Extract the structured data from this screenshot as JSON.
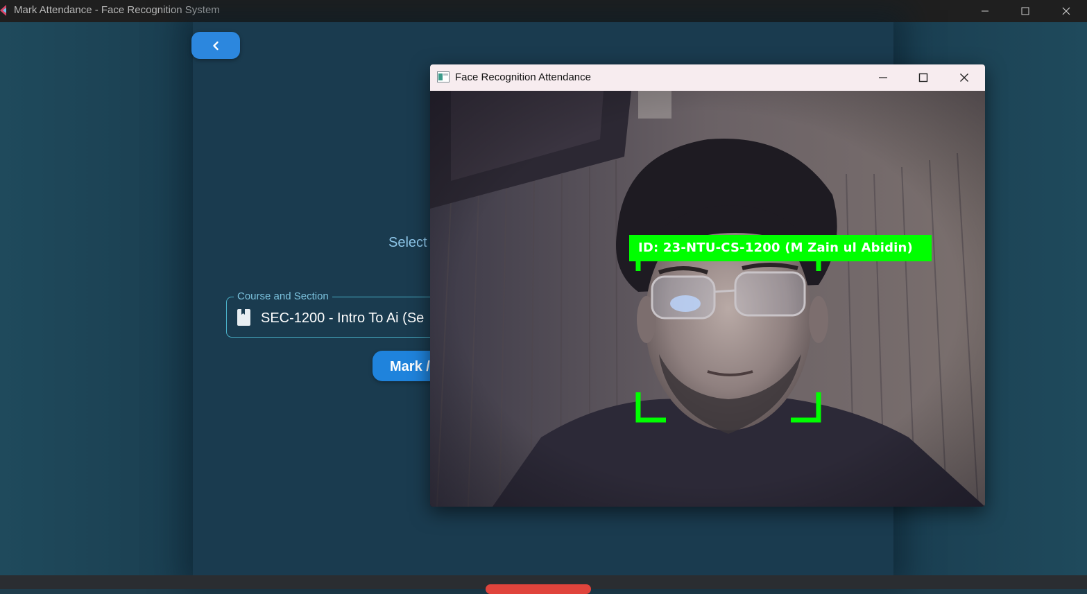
{
  "window": {
    "title": "Mark Attendance - Face Recognition System"
  },
  "page": {
    "select_label": "Select",
    "course_field": {
      "label": "Course and Section",
      "value": "SEC-1200 - Intro To Ai (Se"
    },
    "mark_button_label": "Mark /"
  },
  "camera_window": {
    "title": "Face Recognition Attendance",
    "detection_label": "ID: 23-NTU-CS-1200 (M Zain ul Abidin)"
  },
  "colors": {
    "accent_blue": "#1f83dc",
    "detection_green": "#00ff00",
    "field_border": "#4ab1c9",
    "danger_red": "#e0443c"
  },
  "icons": {
    "back": "chevron-left-icon",
    "course": "book-icon",
    "minimize": "minimize-icon",
    "maximize": "maximize-icon",
    "close": "close-icon"
  }
}
